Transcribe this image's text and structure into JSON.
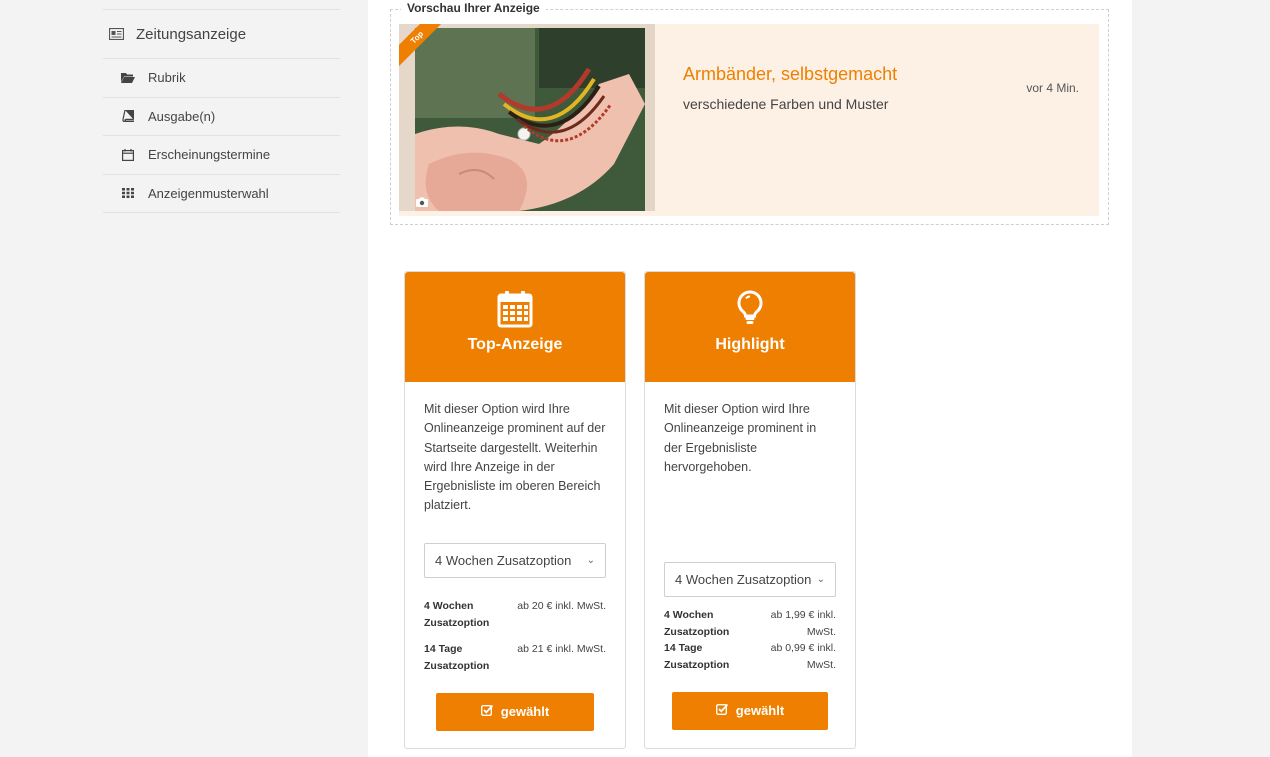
{
  "sidebar": {
    "header": "Zeitungsanzeige",
    "items": [
      {
        "label": "Rubrik"
      },
      {
        "label": "Ausgabe(n)"
      },
      {
        "label": "Erscheinungstermine"
      },
      {
        "label": "Anzeigenmusterwahl"
      }
    ]
  },
  "preview": {
    "legend": "Vorschau Ihrer Anzeige",
    "ribbon": "Top",
    "title": "Armbänder, selbstgemacht",
    "subtitle": "verschiedene Farben und Muster",
    "time": "vor 4 Min."
  },
  "options": [
    {
      "title": "Top-Anzeige",
      "icon": "calendar-icon",
      "description": "Mit dieser Option wird Ihre Onlineanzeige prominent auf der Startseite dargestellt. Weiterhin wird Ihre Anzeige in der Ergebnisliste im oberen Bereich platziert.",
      "select_value": "4 Wochen Zusatzoption",
      "prices": [
        {
          "label": "4 Wochen Zusatzoption",
          "value": "ab 20 € inkl. MwSt."
        },
        {
          "label": "14 Tage Zusatzoption",
          "value": "ab 21 € inkl. MwSt."
        }
      ],
      "button": "gewählt"
    },
    {
      "title": "Highlight",
      "icon": "lightbulb-icon",
      "description": "Mit dieser Option wird Ihre Onlineanzeige prominent in der Ergebnisliste hervorgehoben.",
      "select_value": "4 Wochen Zusatzoption",
      "prices": [
        {
          "label": "4 Wochen Zusatzoption",
          "value": "ab 1,99 € inkl. MwSt."
        },
        {
          "label": "14 Tage Zusatzoption",
          "value": "ab 0,99 € inkl. MwSt."
        }
      ],
      "button": "gewählt"
    }
  ],
  "colors": {
    "accent": "#ee7f00",
    "preview_bg": "#fdf1e6"
  }
}
